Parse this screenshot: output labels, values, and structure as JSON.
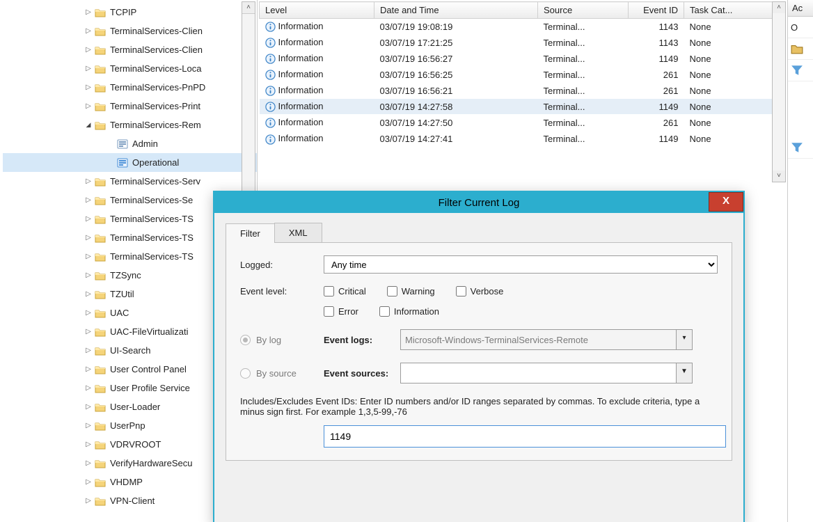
{
  "tree": {
    "items": [
      {
        "label": "TCPIP",
        "expander": "exp",
        "icon": "folder"
      },
      {
        "label": "TerminalServices-Clien",
        "expander": "exp",
        "icon": "folder"
      },
      {
        "label": "TerminalServices-Clien",
        "expander": "exp",
        "icon": "folder"
      },
      {
        "label": "TerminalServices-Loca",
        "expander": "exp",
        "icon": "folder"
      },
      {
        "label": "TerminalServices-PnPD",
        "expander": "exp",
        "icon": "folder"
      },
      {
        "label": "TerminalServices-Print",
        "expander": "exp",
        "icon": "folder"
      },
      {
        "label": "TerminalServices-Rem",
        "expander": "col",
        "icon": "folder",
        "expanded": true
      },
      {
        "label": " Admin",
        "expander": "none",
        "icon": "log",
        "child": true
      },
      {
        "label": " Operational",
        "expander": "none",
        "icon": "logsel",
        "child": true,
        "selected": true
      },
      {
        "label": "TerminalServices-Serv",
        "expander": "exp",
        "icon": "folder"
      },
      {
        "label": "TerminalServices-Se",
        "expander": "exp",
        "icon": "folder"
      },
      {
        "label": "TerminalServices-TS",
        "expander": "exp",
        "icon": "folder"
      },
      {
        "label": "TerminalServices-TS",
        "expander": "exp",
        "icon": "folder"
      },
      {
        "label": "TerminalServices-TS",
        "expander": "exp",
        "icon": "folder"
      },
      {
        "label": "TZSync",
        "expander": "exp",
        "icon": "folder"
      },
      {
        "label": "TZUtil",
        "expander": "exp",
        "icon": "folder"
      },
      {
        "label": "UAC",
        "expander": "exp",
        "icon": "folder"
      },
      {
        "label": "UAC-FileVirtualizati",
        "expander": "exp",
        "icon": "folder"
      },
      {
        "label": "UI-Search",
        "expander": "exp",
        "icon": "folder"
      },
      {
        "label": "User Control Panel",
        "expander": "exp",
        "icon": "folder"
      },
      {
        "label": "User Profile Service",
        "expander": "exp",
        "icon": "folder"
      },
      {
        "label": "User-Loader",
        "expander": "exp",
        "icon": "folder"
      },
      {
        "label": "UserPnp",
        "expander": "exp",
        "icon": "folder"
      },
      {
        "label": "VDRVROOT",
        "expander": "exp",
        "icon": "folder"
      },
      {
        "label": "VerifyHardwareSecu",
        "expander": "exp",
        "icon": "folder"
      },
      {
        "label": "VHDMP",
        "expander": "exp",
        "icon": "folder"
      },
      {
        "label": "VPN-Client",
        "expander": "exp",
        "icon": "folder"
      }
    ]
  },
  "columns": {
    "level": "Level",
    "date": "Date and Time",
    "source": "Source",
    "eventid": "Event ID",
    "task": "Task Cat..."
  },
  "events": [
    {
      "level": "Information",
      "date": "03/07/19 19:08:19",
      "source": "Terminal...",
      "id": "1143",
      "task": "None"
    },
    {
      "level": "Information",
      "date": "03/07/19 17:21:25",
      "source": "Terminal...",
      "id": "1143",
      "task": "None"
    },
    {
      "level": "Information",
      "date": "03/07/19 16:56:27",
      "source": "Terminal...",
      "id": "1149",
      "task": "None"
    },
    {
      "level": "Information",
      "date": "03/07/19 16:56:25",
      "source": "Terminal...",
      "id": "261",
      "task": "None"
    },
    {
      "level": "Information",
      "date": "03/07/19 16:56:21",
      "source": "Terminal...",
      "id": "261",
      "task": "None"
    },
    {
      "level": "Information",
      "date": "03/07/19 14:27:58",
      "source": "Terminal...",
      "id": "1149",
      "task": "None",
      "selected": true
    },
    {
      "level": "Information",
      "date": "03/07/19 14:27:50",
      "source": "Terminal...",
      "id": "261",
      "task": "None"
    },
    {
      "level": "Information",
      "date": "03/07/19 14:27:41",
      "source": "Terminal...",
      "id": "1149",
      "task": "None"
    }
  ],
  "actions": {
    "header": "Ac",
    "row0": "O"
  },
  "dialog": {
    "title": "Filter Current Log",
    "close": "X",
    "tabs": {
      "filter": "Filter",
      "xml": "XML"
    },
    "logged_label": "Logged:",
    "logged_value": "Any time",
    "level_label": "Event level:",
    "levels": {
      "critical": "Critical",
      "warning": "Warning",
      "verbose": "Verbose",
      "error": "Error",
      "information": "Information"
    },
    "bylog": "By log",
    "bysource": "By source",
    "eventlogs_label": "Event logs:",
    "eventlogs_value": "Microsoft-Windows-TerminalServices-Remote",
    "eventsources_label": "Event sources:",
    "eventsources_value": "",
    "hint": "Includes/Excludes Event IDs: Enter ID numbers and/or ID ranges separated by commas. To exclude criteria, type a minus sign first. For example 1,3,5-99,-76",
    "idvalue": "1149"
  }
}
